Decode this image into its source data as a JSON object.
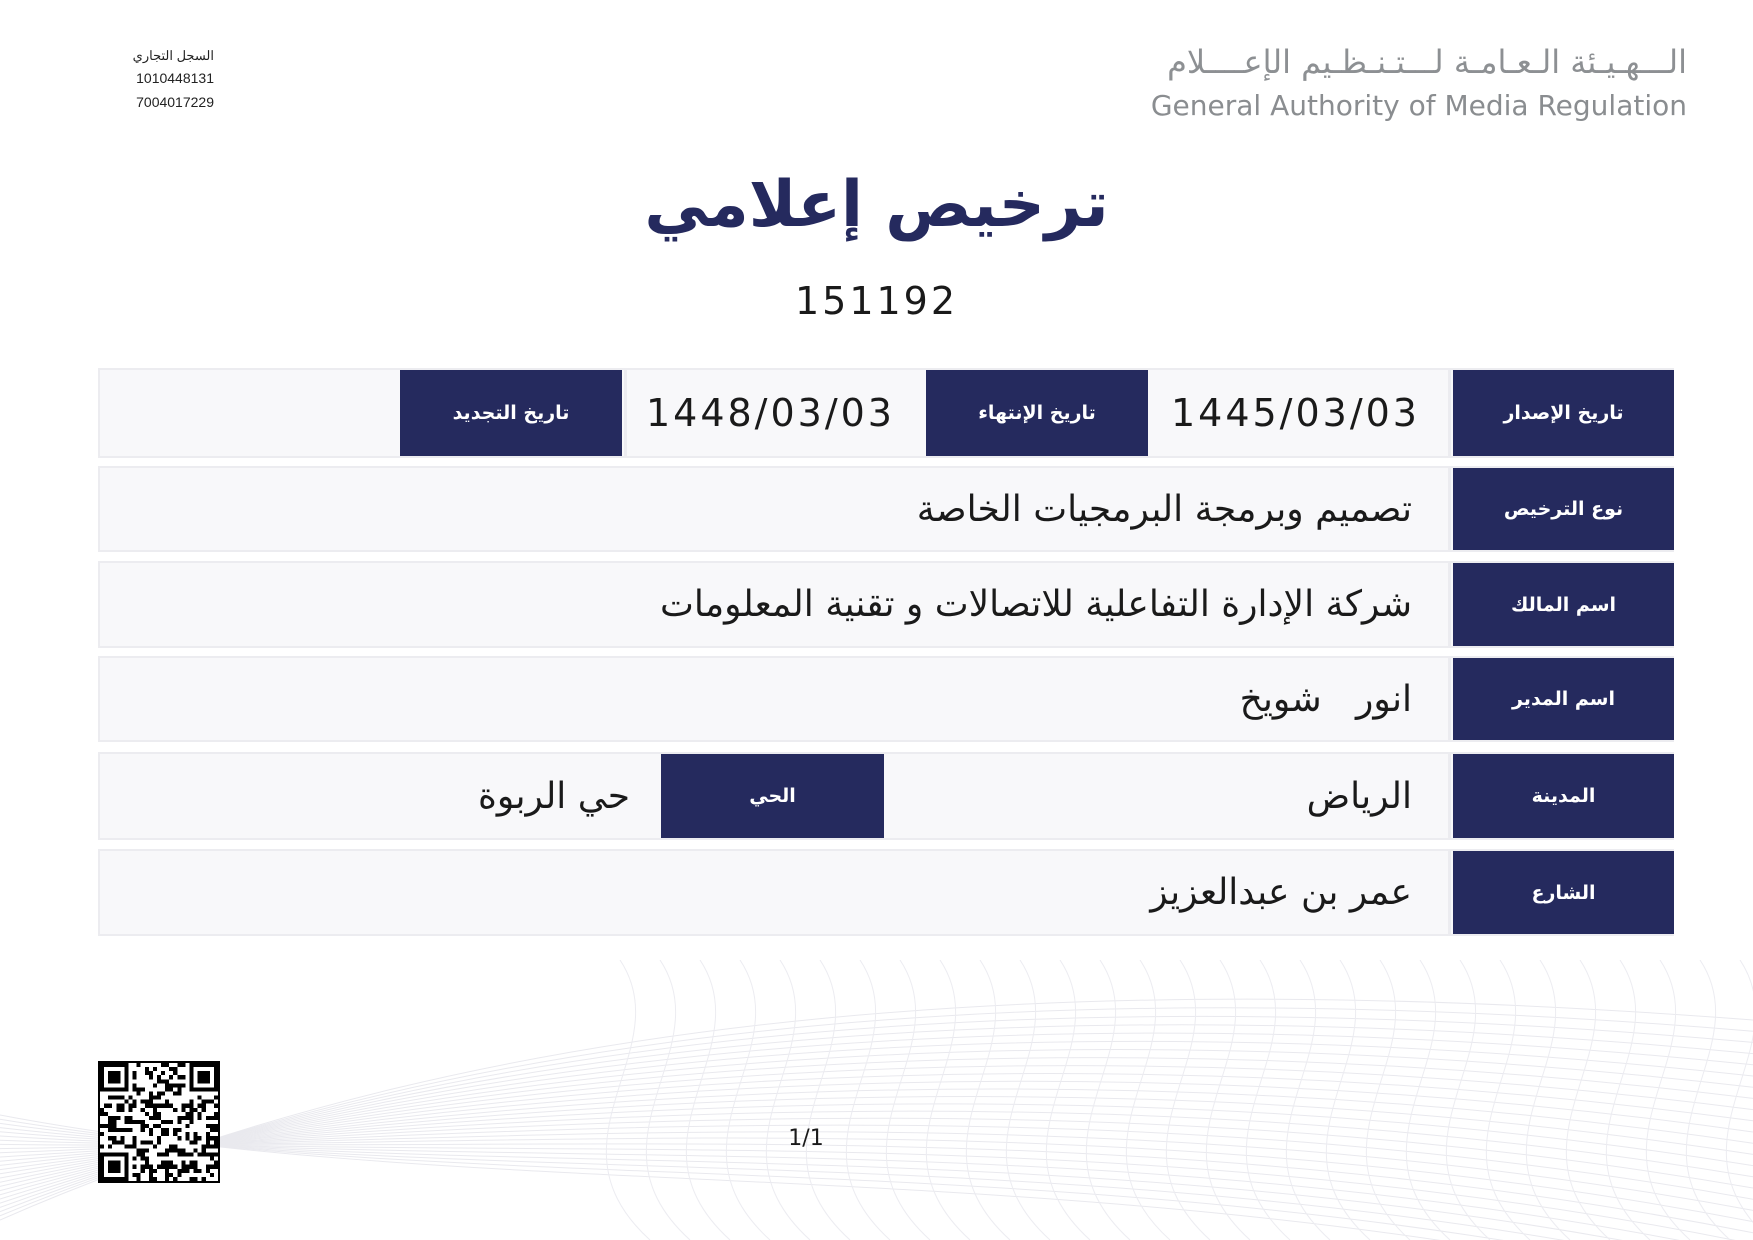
{
  "header": {
    "cr_label": "السجل التجاري",
    "cr_number": "1010448131",
    "unified_number": "7004017229",
    "logo_ar": "الـــهـيـئة الـعـامـة لـــتـنـظـيم الإعــــلام",
    "logo_en": "General Authority of Media Regulation"
  },
  "document": {
    "title": "ترخيص إعلامي",
    "license_number": "151192"
  },
  "fields": {
    "issue_date_label": "تاريخ الإصدار",
    "issue_date": "1445/03/03",
    "expiry_date_label": "تاريخ الإنتهاء",
    "expiry_date": "1448/03/03",
    "renewal_date_label": "تاريخ التجديد",
    "renewal_date": "",
    "license_type_label": "نوع الترخيص",
    "license_type": "تصميم وبرمجة البرمجيات الخاصة",
    "owner_label": "اسم المالك",
    "owner": "شركة الإدارة التفاعلية للاتصالات و تقنية المعلومات",
    "manager_label": "اسم المدير",
    "manager": "انور   شويخ",
    "city_label": "المدينة",
    "city": "الرياض",
    "district_label": "الحي",
    "district": "حي الربوة",
    "street_label": "الشارع",
    "street": "عمر بن عبدالعزيز"
  },
  "footer": {
    "page_indicator": "1/1",
    "qr_icon": "qr-code-icon"
  }
}
